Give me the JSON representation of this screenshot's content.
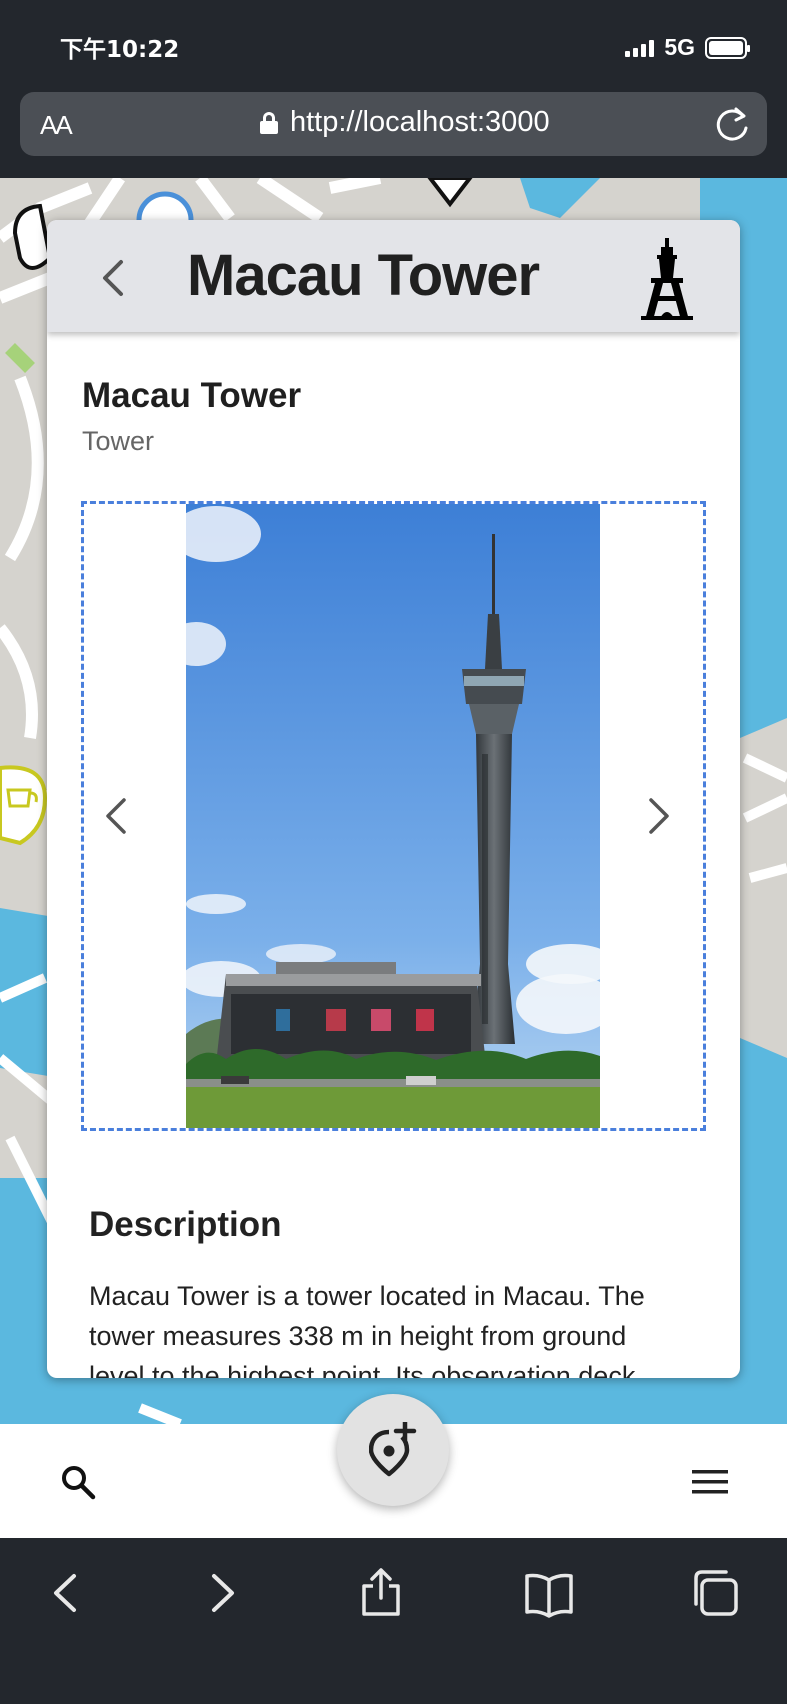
{
  "status": {
    "time": "下午10:22",
    "network": "5G"
  },
  "browser": {
    "text_size_label": "AA",
    "url": "http://localhost:3000"
  },
  "card": {
    "header_title": "Macau Tower",
    "place_name": "Macau Tower",
    "place_type": "Tower",
    "description_heading": "Description",
    "description_text": "Macau Tower is a tower located in Macau. The tower measures 338 m in height from ground level to the highest point. Its observation deck"
  },
  "icons": {
    "back": "chevron-left-icon",
    "category": "tower-icon",
    "gallery_prev": "chevron-left-icon",
    "gallery_next": "chevron-right-icon",
    "search": "search-icon",
    "add_place": "add-location-icon",
    "menu": "hamburger-menu-icon"
  },
  "colors": {
    "map_water": "#5bb8df",
    "map_land": "#d5d3ce",
    "gallery_border": "#4a7fdc",
    "header_bg": "#e3e4e8",
    "browser_chrome": "#23272d"
  }
}
